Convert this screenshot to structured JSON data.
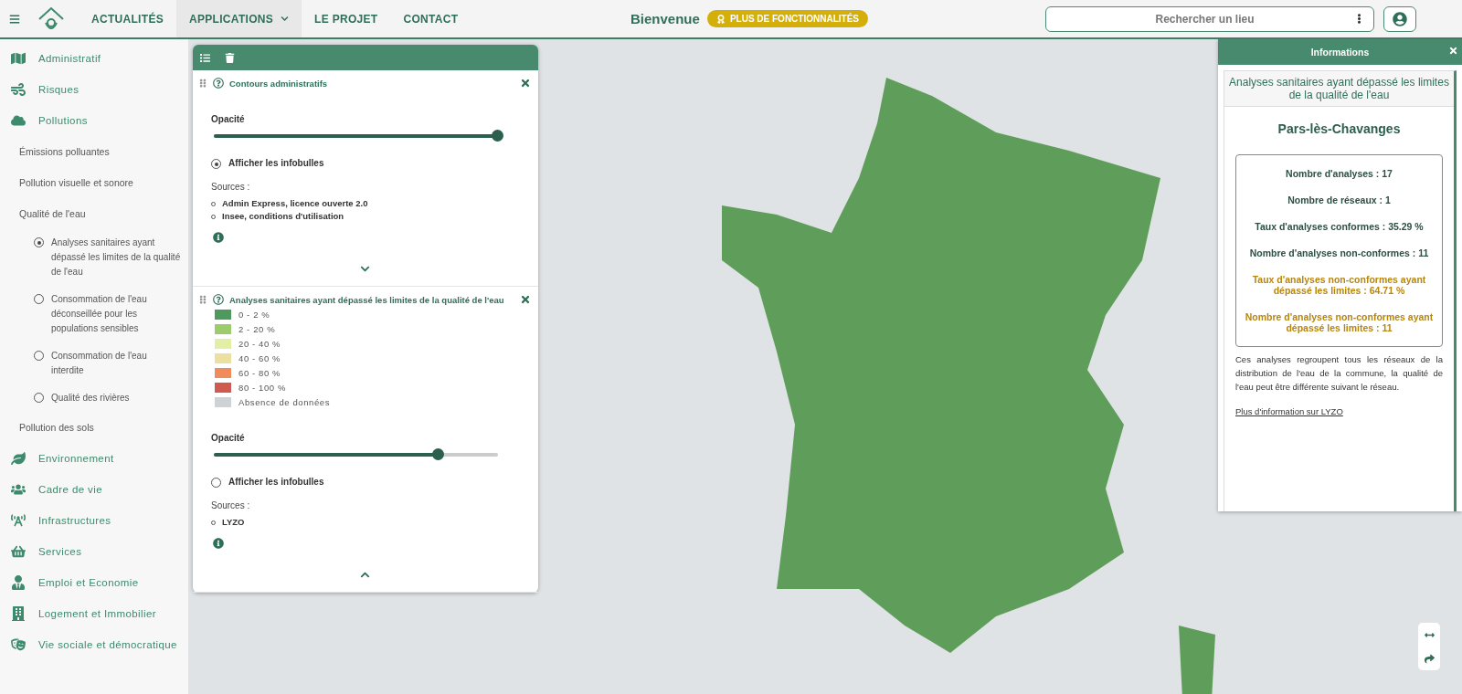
{
  "header": {
    "nav": [
      {
        "label": "ACTUALITÉS",
        "selected": false,
        "dropdown": false
      },
      {
        "label": "APPLICATIONS",
        "selected": true,
        "dropdown": true
      },
      {
        "label": "LE PROJET",
        "selected": false,
        "dropdown": false
      },
      {
        "label": "CONTACT",
        "selected": false,
        "dropdown": false
      }
    ],
    "welcome": "Bienvenue",
    "badge": "PLUS DE FONCTIONNALITÉS",
    "search": {
      "placeholder": "Rechercher un lieu"
    }
  },
  "sidebar": {
    "items": [
      {
        "label": "Administratif"
      },
      {
        "label": "Risques"
      },
      {
        "label": "Pollutions",
        "children": [
          {
            "label": "Émissions polluantes"
          },
          {
            "label": "Pollution visuelle et sonore"
          },
          {
            "label": "Qualité de l'eau",
            "children": [
              {
                "label": "Analyses sanitaires ayant dépassé les limites de la qualité de l'eau",
                "selected": true
              },
              {
                "label": "Consommation de l'eau déconseillée pour les populations sensibles",
                "selected": false
              },
              {
                "label": "Consommation de l'eau interdite",
                "selected": false
              },
              {
                "label": "Qualité des rivières",
                "selected": false
              }
            ]
          },
          {
            "label": "Pollution des sols"
          }
        ]
      },
      {
        "label": "Environnement"
      },
      {
        "label": "Cadre de vie"
      },
      {
        "label": "Infrastructures"
      },
      {
        "label": "Services"
      },
      {
        "label": "Emploi et Economie"
      },
      {
        "label": "Logement et Immobilier"
      },
      {
        "label": "Vie sociale et démocratique"
      }
    ]
  },
  "layers": [
    {
      "title": "Contours administratifs",
      "opacity_label": "Opacité",
      "level": 1,
      "tooltips": {
        "label": "Afficher les infobulles",
        "checked": true
      },
      "sources_label": "Sources :",
      "sources": [
        "Admin Express, licence ouverte 2.0",
        "Insee, conditions d'utilisation"
      ],
      "expanded": false
    },
    {
      "title": "Analyses sanitaires ayant dépassé les limites de la qualité de l'eau",
      "legend": [
        {
          "label": "0 - 2 %",
          "color": "#4e9a5e"
        },
        {
          "label": "2 - 20 %",
          "color": "#9ccc6c"
        },
        {
          "label": "20 - 40 %",
          "color": "#e2efa4"
        },
        {
          "label": "40 - 60 %",
          "color": "#ebe0a0"
        },
        {
          "label": "60 - 80 %",
          "color": "#f08c5c"
        },
        {
          "label": "80 - 100 %",
          "color": "#cf5a50"
        },
        {
          "label": "Absence de données",
          "color": "#cfd2d4"
        }
      ],
      "opacity_label": "Opacité",
      "level": 0.79,
      "tooltips": {
        "label": "Afficher les infobulles",
        "checked": false
      },
      "sources_label": "Sources :",
      "sources": [
        "LYZO"
      ],
      "expanded": true
    }
  ],
  "info": {
    "title": "Informations",
    "subtitle": "Analyses sanitaires ayant dépassé les limites de la qualité de l'eau",
    "place": "Pars-lès-Chavanges",
    "stats": [
      {
        "text": "Nombre d'analyses : 17",
        "highlight": false
      },
      {
        "text": "Nombre de réseaux : 1",
        "highlight": false
      },
      {
        "text": "Taux d'analyses conformes : 35.29 %",
        "highlight": false
      },
      {
        "text": "Nombre d'analyses non-conformes : 11",
        "highlight": false
      },
      {
        "text": "Taux d'analyses non-conformes ayant dépassé les limites : 64.71 %",
        "highlight": true
      },
      {
        "text": "Nombre d'analyses non-conformes ayant dépassé les limites : 11",
        "highlight": true
      }
    ],
    "note": "Ces analyses regroupent tous les réseaux de la distribution de l'eau de la commune, la qualité de l'eau peut être différente suivant le réseau.",
    "link": "Plus d'information sur LYZO"
  }
}
